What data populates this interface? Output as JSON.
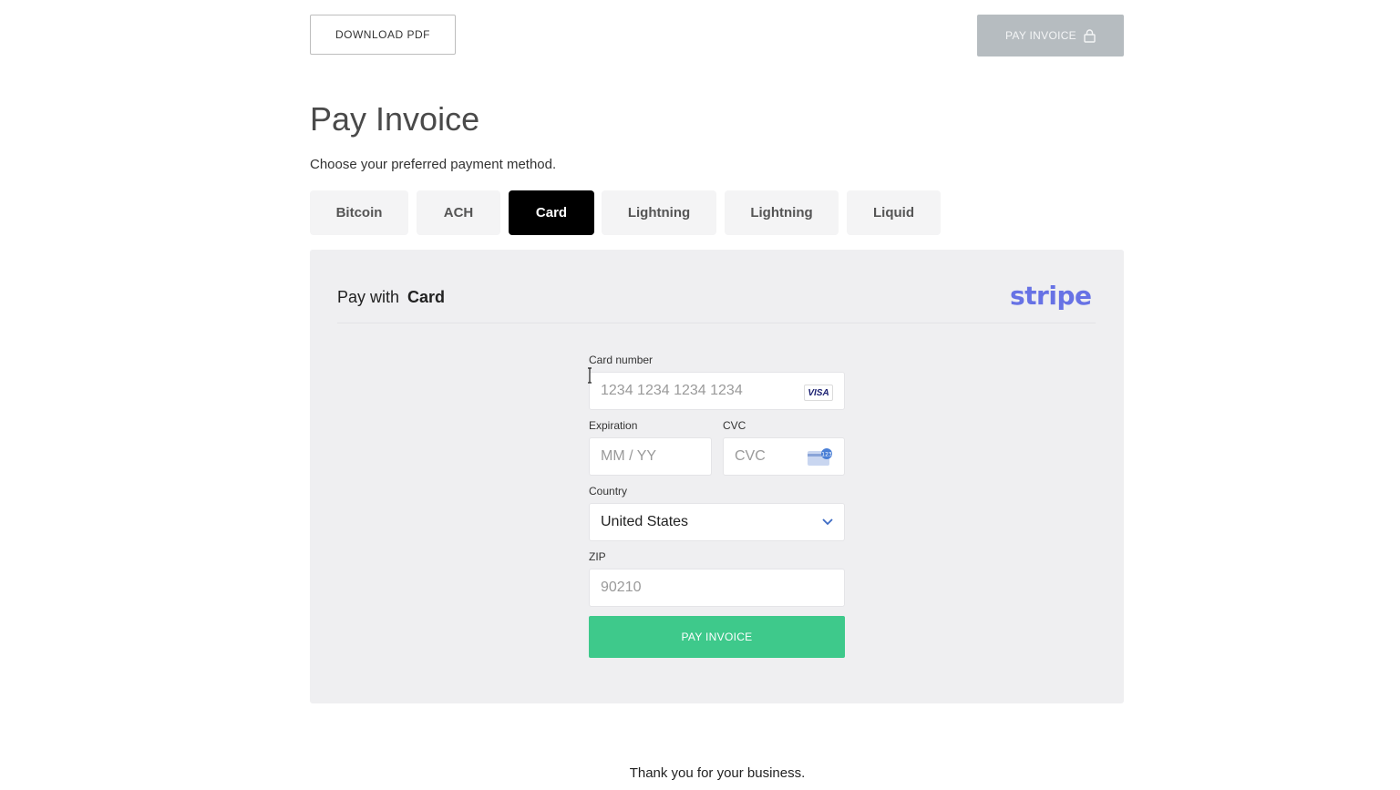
{
  "header": {
    "download_label": "DOWNLOAD PDF",
    "pay_label": "PAY INVOICE",
    "pay_icon": "lock-icon"
  },
  "page": {
    "title": "Pay Invoice",
    "subtitle": "Choose your preferred payment method."
  },
  "tabs": [
    {
      "label": "Bitcoin",
      "active": false
    },
    {
      "label": "ACH",
      "active": false
    },
    {
      "label": "Card",
      "active": true
    },
    {
      "label": "Lightning",
      "active": false
    },
    {
      "label": "Lightning",
      "active": false
    },
    {
      "label": "Liquid",
      "active": false
    }
  ],
  "panel": {
    "heading_prefix": "Pay with",
    "heading_method": "Card",
    "provider_logo": "stripe"
  },
  "form": {
    "card_number": {
      "label": "Card number",
      "placeholder": "1234 1234 1234 1234",
      "brand": "VISA"
    },
    "expiration": {
      "label": "Expiration",
      "placeholder": "MM / YY"
    },
    "cvc": {
      "label": "CVC",
      "placeholder": "CVC",
      "icon": "cvc-card-icon"
    },
    "country": {
      "label": "Country",
      "value": "United States"
    },
    "zip": {
      "label": "ZIP",
      "placeholder": "90210"
    },
    "submit_label": "PAY INVOICE"
  },
  "footer": {
    "text": "Thank you for your business."
  },
  "colors": {
    "accent_green": "#3ec98b",
    "stripe_purple": "#6772e5",
    "active_tab": "#000000",
    "disabled_button": "#b6bcc0"
  }
}
